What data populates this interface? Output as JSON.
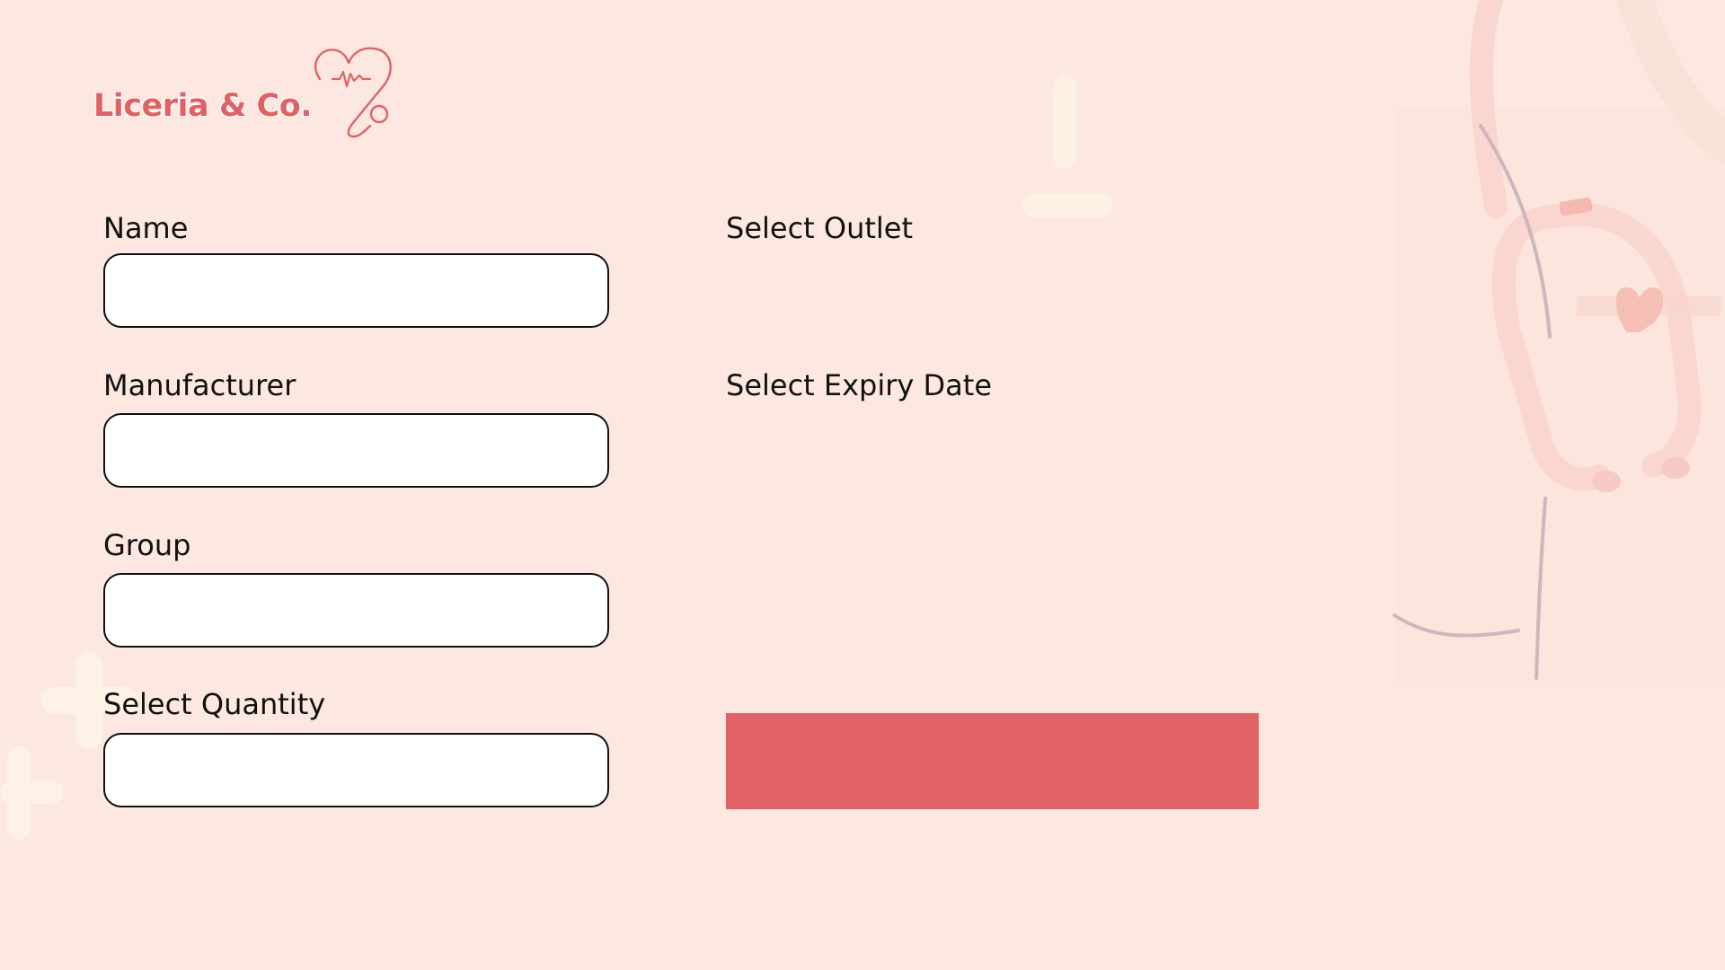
{
  "brand": {
    "name": "Liceria & Co.",
    "color": "#E06264",
    "icon": "heart-stethoscope-icon"
  },
  "colors": {
    "background": "#FDE8E1",
    "accent": "#E06264",
    "input_border": "#111111"
  },
  "form": {
    "name": {
      "label": "Name",
      "value": "",
      "placeholder": ""
    },
    "manufacturer": {
      "label": "Manufacturer",
      "value": "",
      "placeholder": ""
    },
    "group": {
      "label": "Group",
      "value": "",
      "placeholder": ""
    },
    "quantity": {
      "label": "Select Quantity",
      "value": "",
      "placeholder": ""
    },
    "outlet": {
      "label": "Select Outlet"
    },
    "expiry": {
      "label": "Select Expiry Date"
    },
    "submit": {
      "label": ""
    }
  },
  "decorations": {
    "background_icons": [
      "plus-icon",
      "stethoscope-icon",
      "heart-icon"
    ]
  }
}
